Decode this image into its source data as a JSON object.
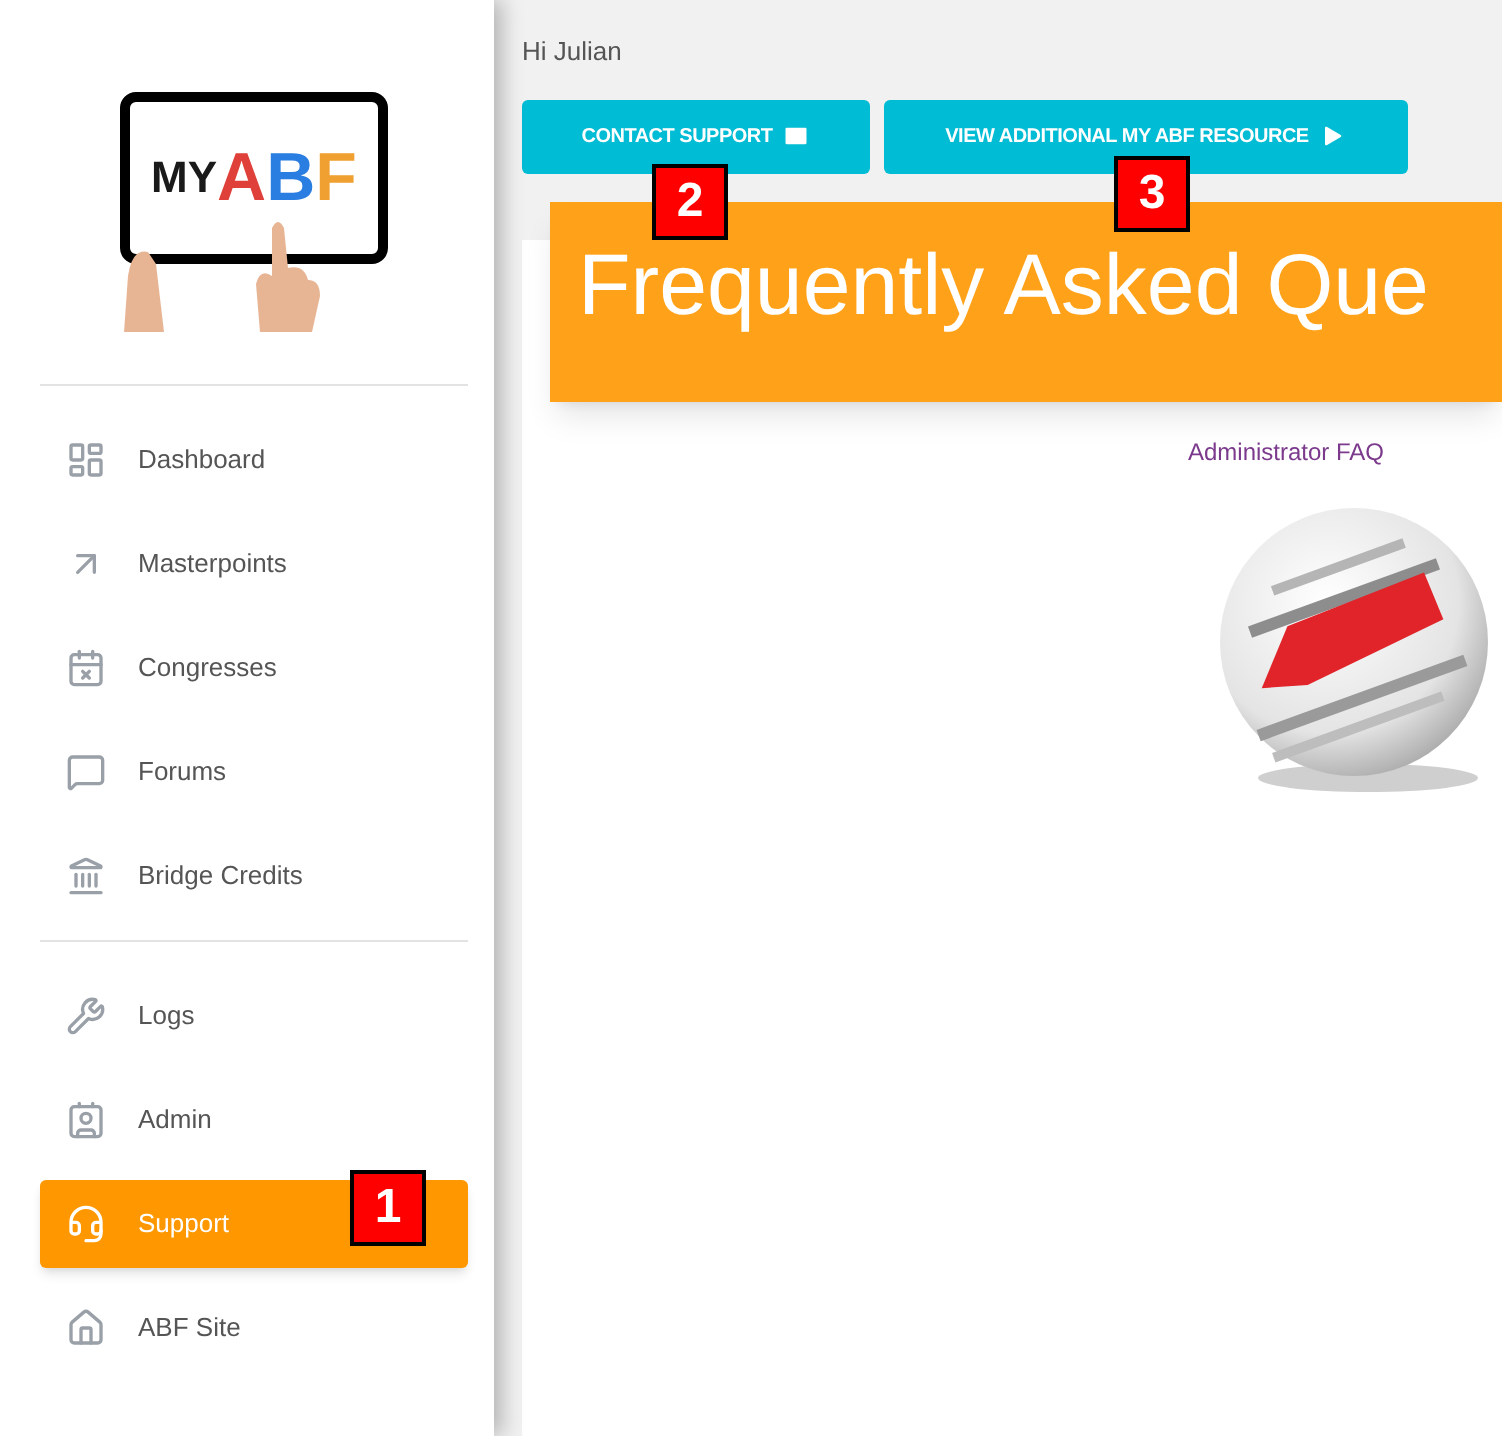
{
  "logo": {
    "parts": [
      {
        "text": "MY",
        "color": "#1a1a1a"
      },
      {
        "text": "A",
        "color": "#e0403a"
      },
      {
        "text": "B",
        "color": "#2a7de1"
      },
      {
        "text": "F",
        "color": "#f0a030"
      }
    ]
  },
  "sidebar": {
    "groups": [
      [
        {
          "label": "Dashboard",
          "selected": false
        },
        {
          "label": "Masterpoints",
          "selected": false
        },
        {
          "label": "Congresses",
          "selected": false
        },
        {
          "label": "Forums",
          "selected": false
        },
        {
          "label": "Bridge Credits",
          "selected": false
        }
      ],
      [
        {
          "label": "Logs",
          "selected": false
        },
        {
          "label": "Admin",
          "selected": false
        },
        {
          "label": "Support",
          "selected": true
        },
        {
          "label": "ABF Site",
          "selected": false
        }
      ]
    ]
  },
  "greeting": "Hi Julian",
  "buttons": [
    {
      "label": "CONTACT SUPPORT"
    },
    {
      "label": "VIEW ADDITIONAL MY ABF RESOURCE"
    }
  ],
  "header": {
    "title": "Frequently Asked Que"
  },
  "faq_link": "Administrator FAQ",
  "faq_image": {
    "kind": "picture"
  },
  "callouts": [
    "1",
    "2",
    "3"
  ]
}
